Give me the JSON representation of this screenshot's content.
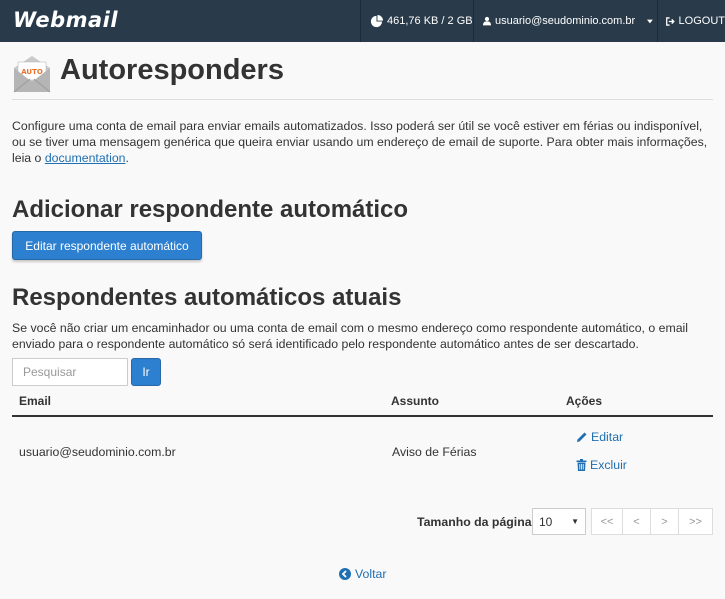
{
  "topbar": {
    "logo": "Webmail",
    "quota": "461,76 KB / 2 GB",
    "user": "usuario@seudominio.com.br",
    "logout": "LOGOUT"
  },
  "page": {
    "icon_badge": "AUTO",
    "title": "Autoresponders",
    "description_before_link": "Configure uma conta de email para enviar emails automatizados. Isso poderá ser útil se você estiver em férias ou indisponível, ou se tiver uma mensagem genérica que queira enviar usando um endereço de email de suporte. Para obter mais informações, leia o ",
    "description_link": "documentation",
    "description_after_link": "."
  },
  "add_section": {
    "heading": "Adicionar respondente automático",
    "button_label": "Editar respondente automático"
  },
  "current_section": {
    "heading": "Respondentes automáticos atuais",
    "note": "Se você não criar um encaminhador ou uma conta de email com o mesmo endereço como respondente automático, o email enviado para o respondente automático só será identificado pelo respondente automático antes de ser descartado.",
    "search": {
      "placeholder": "Pesquisar",
      "value": "",
      "button_label": "Ir"
    },
    "table": {
      "columns": [
        "Email",
        "Assunto",
        "Ações"
      ],
      "rows": [
        {
          "email": "usuario@seudominio.com.br",
          "subject": "Aviso de Férias",
          "actions": [
            "Editar",
            "Excluir"
          ]
        }
      ]
    },
    "pagination": {
      "page_size_label": "Tamanho da página",
      "page_size": "10",
      "buttons": [
        "<<",
        "<",
        ">",
        ">>"
      ]
    }
  },
  "back_link": "Voltar",
  "colors": {
    "topbar": "#293a4a",
    "primary": "#2d7fcf",
    "link": "#1f6fb2"
  },
  "icons": [
    "pie-chart-icon",
    "user-icon",
    "caret-down-icon",
    "logout-icon",
    "autoresponder-envelope-icon",
    "pencil-icon",
    "trash-icon",
    "arrow-circle-left-icon"
  ]
}
